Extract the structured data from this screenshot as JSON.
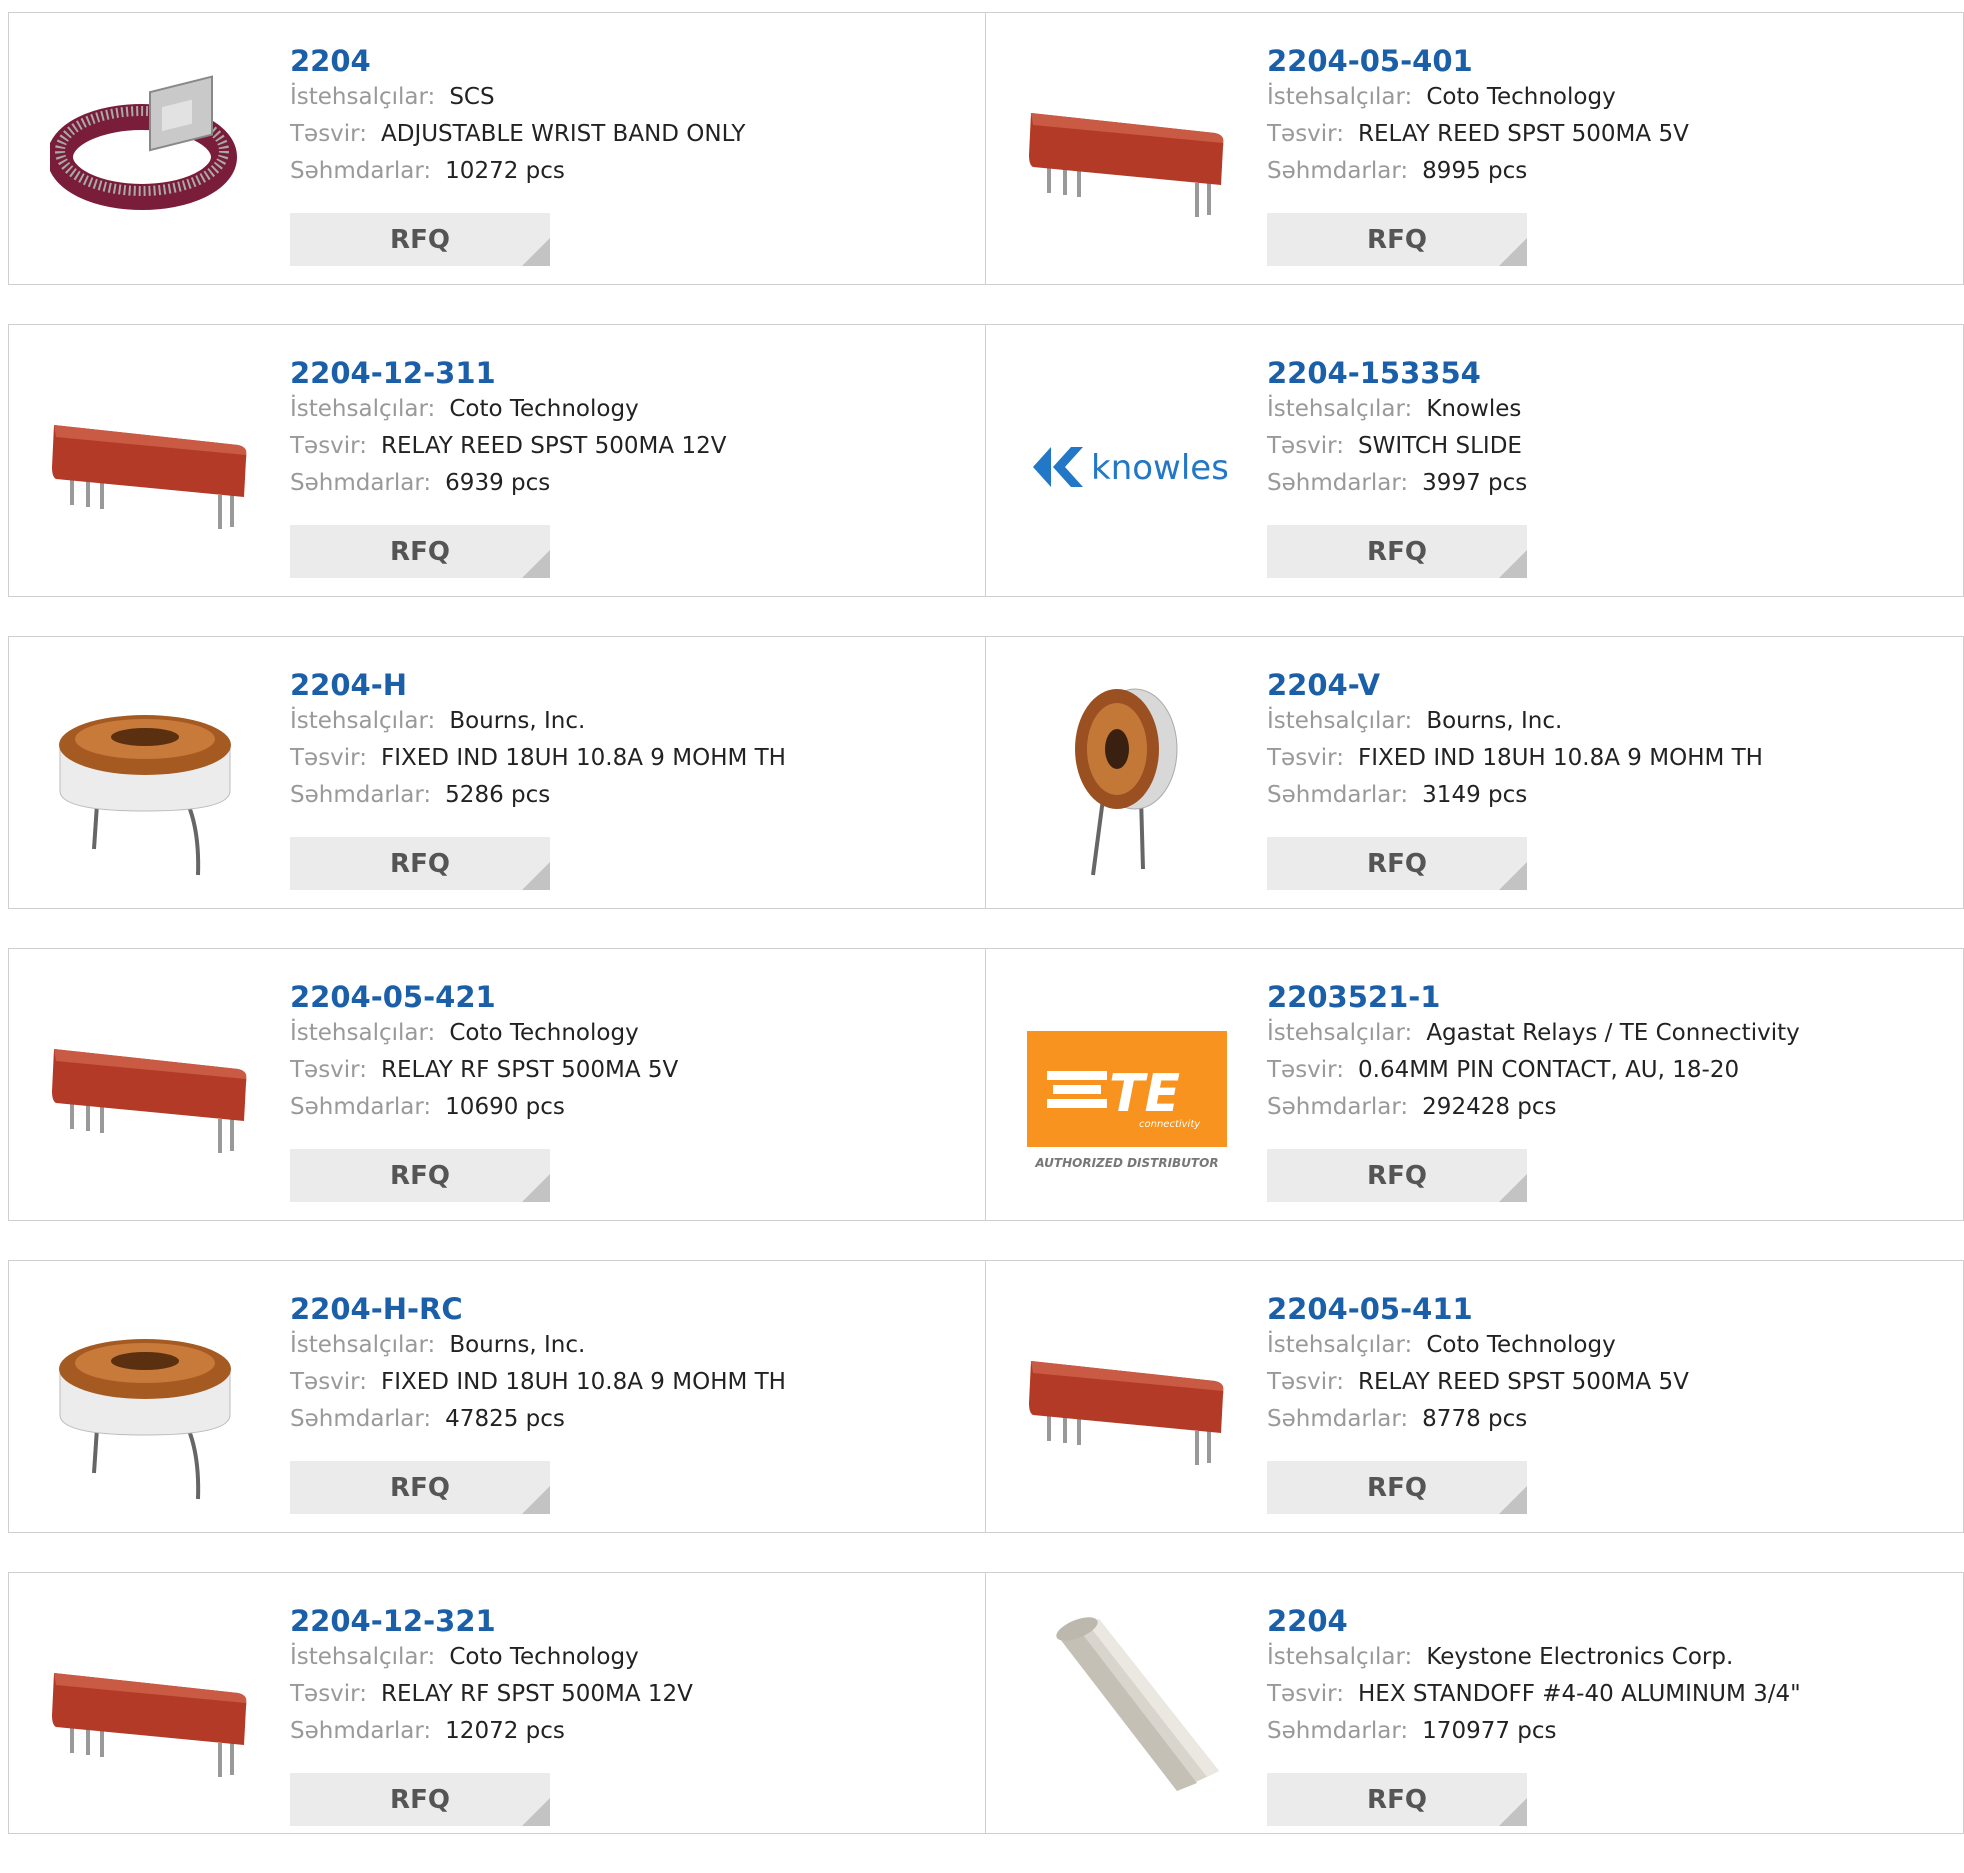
{
  "labels": {
    "manufacturer": "İstehsalçılar:",
    "description": "Təsvir:",
    "stock": "Səhmdarlar:",
    "rfq": "RFQ"
  },
  "colors": {
    "part_link": "#1a5fa8",
    "relay_red": "#b33a26",
    "te_orange": "#f7931e",
    "knowles_blue": "#2277c6"
  },
  "products": [
    {
      "part": "2204",
      "manufacturer": "SCS",
      "description": "ADJUSTABLE WRIST BAND ONLY",
      "stock": "10272 pcs",
      "image": "wrist-band-image"
    },
    {
      "part": "2204-05-401",
      "manufacturer": "Coto Technology",
      "description": "RELAY REED SPST 500MA 5V",
      "stock": "8995 pcs",
      "image": "reed-relay-image"
    },
    {
      "part": "2204-12-311",
      "manufacturer": "Coto Technology",
      "description": "RELAY REED SPST 500MA 12V",
      "stock": "6939 pcs",
      "image": "reed-relay-image"
    },
    {
      "part": "2204-153354",
      "manufacturer": "Knowles",
      "description": "SWITCH SLIDE",
      "stock": "3997 pcs",
      "image": "knowles-logo",
      "logo_text": "knowles"
    },
    {
      "part": "2204-H",
      "manufacturer": "Bourns, Inc.",
      "description": "FIXED IND 18UH 10.8A 9 MOHM TH",
      "stock": "5286 pcs",
      "image": "toroid-inductor-horizontal-image"
    },
    {
      "part": "2204-V",
      "manufacturer": "Bourns, Inc.",
      "description": "FIXED IND 18UH 10.8A 9 MOHM TH",
      "stock": "3149 pcs",
      "image": "toroid-inductor-vertical-image"
    },
    {
      "part": "2204-05-421",
      "manufacturer": "Coto Technology",
      "description": "RELAY RF SPST 500MA 5V",
      "stock": "10690 pcs",
      "image": "reed-relay-image"
    },
    {
      "part": "2203521-1",
      "manufacturer": "Agastat Relays / TE Connectivity",
      "description": "0.64MM PIN CONTACT, AU, 18-20",
      "stock": "292428 pcs",
      "image": "te-connectivity-logo",
      "logo_text": "TE",
      "logo_sub": "connectivity",
      "logo_caption": "AUTHORIZED DISTRIBUTOR"
    },
    {
      "part": "2204-H-RC",
      "manufacturer": "Bourns, Inc.",
      "description": "FIXED IND 18UH 10.8A 9 MOHM TH",
      "stock": "47825 pcs",
      "image": "toroid-inductor-horizontal-image"
    },
    {
      "part": "2204-05-411",
      "manufacturer": "Coto Technology",
      "description": "RELAY REED SPST 500MA 5V",
      "stock": "8778 pcs",
      "image": "reed-relay-image"
    },
    {
      "part": "2204-12-321",
      "manufacturer": "Coto Technology",
      "description": "RELAY RF SPST 500MA 12V",
      "stock": "12072 pcs",
      "image": "reed-relay-image"
    },
    {
      "part": "2204",
      "manufacturer": "Keystone Electronics Corp.",
      "description": "HEX STANDOFF #4-40 ALUMINUM 3/4\"",
      "stock": "170977 pcs",
      "image": "hex-standoff-image"
    }
  ]
}
